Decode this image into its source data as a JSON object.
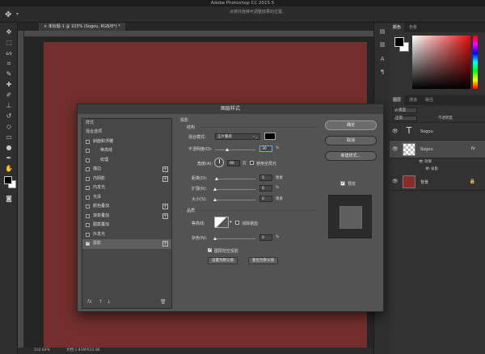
{
  "app": {
    "title": "Adobe Photoshop CC 2015.5",
    "hint": "点按并拖移可调整效果的位置。"
  },
  "document": {
    "tab": "未标题-1 @ 103% (Sogou, RGB/8*) *",
    "canvas_color": "#722f2d",
    "zoom": "102.64%",
    "doc_size": "文档:1.83M/632.8K"
  },
  "panels": {
    "color_tabs": [
      "颜色",
      "色板"
    ],
    "layers_tabs": [
      "图层",
      "通道",
      "路径"
    ],
    "kind_label": "ρ 类型",
    "blend_label": "正常",
    "opacity_label": "不透明度",
    "layers": [
      {
        "name": "Sogou",
        "type": "text",
        "thumb": "T"
      },
      {
        "name": "Sogou",
        "type": "smart",
        "fx": "fx"
      },
      {
        "name": "背景",
        "type": "background",
        "color": "#8b2b2b"
      }
    ],
    "effects_label": "效果",
    "effect_item": "投影"
  },
  "dialog": {
    "title": "图层样式",
    "list_header": "样式",
    "items": [
      {
        "label": "混合选项",
        "checkbox": false,
        "plus": false
      },
      {
        "label": "斜面和浮雕",
        "checkbox": true,
        "checked": false,
        "plus": false
      },
      {
        "label": "等高线",
        "checkbox": true,
        "checked": false,
        "plus": false,
        "indent": true
      },
      {
        "label": "纹理",
        "checkbox": true,
        "checked": false,
        "plus": false,
        "indent": true
      },
      {
        "label": "描边",
        "checkbox": true,
        "checked": false,
        "plus": true
      },
      {
        "label": "内阴影",
        "checkbox": true,
        "checked": false,
        "plus": true
      },
      {
        "label": "内发光",
        "checkbox": true,
        "checked": false,
        "plus": false
      },
      {
        "label": "光泽",
        "checkbox": true,
        "checked": false,
        "plus": false
      },
      {
        "label": "颜色叠加",
        "checkbox": true,
        "checked": false,
        "plus": true
      },
      {
        "label": "渐变叠加",
        "checkbox": true,
        "checked": false,
        "plus": true
      },
      {
        "label": "图案叠加",
        "checkbox": true,
        "checked": false,
        "plus": false
      },
      {
        "label": "外发光",
        "checkbox": true,
        "checked": false,
        "plus": false
      },
      {
        "label": "投影",
        "checkbox": true,
        "checked": true,
        "plus": true,
        "selected": true
      }
    ],
    "footer_icons": [
      "fx",
      "↑",
      "↓",
      "🗑"
    ],
    "section_title": "投影",
    "structure_label": "结构",
    "blend_mode_label": "混合模式:",
    "blend_mode_value": "正片叠底",
    "opacity_label": "不透明度(O):",
    "opacity_value": "30",
    "angle_label": "角度(A):",
    "angle_value": "90",
    "global_light_label": "使用全局光",
    "distance_label": "距离(D):",
    "distance_value": "5",
    "spread_label": "扩展(R):",
    "spread_value": "0",
    "size_label": "大小(S):",
    "size_value": "0",
    "quality_label": "品质",
    "contour_label": "等高线:",
    "antialias_label": "消除锯齿",
    "noise_label": "杂色(N):",
    "noise_value": "0",
    "knockout_label": "图层挖空投影",
    "make_default": "设置为默认值",
    "reset_default": "复位为默认值",
    "ok": "确定",
    "cancel": "取消",
    "new_style": "新建样式...",
    "preview": "预览",
    "unit_pct": "%",
    "unit_deg": "度",
    "unit_px": "像素",
    "shadow_color": "#000000",
    "opacity_level": 0.3,
    "distance_level": 0.05,
    "spread_level": 0.0,
    "size_level": 0.0,
    "noise_level": 0.0
  }
}
